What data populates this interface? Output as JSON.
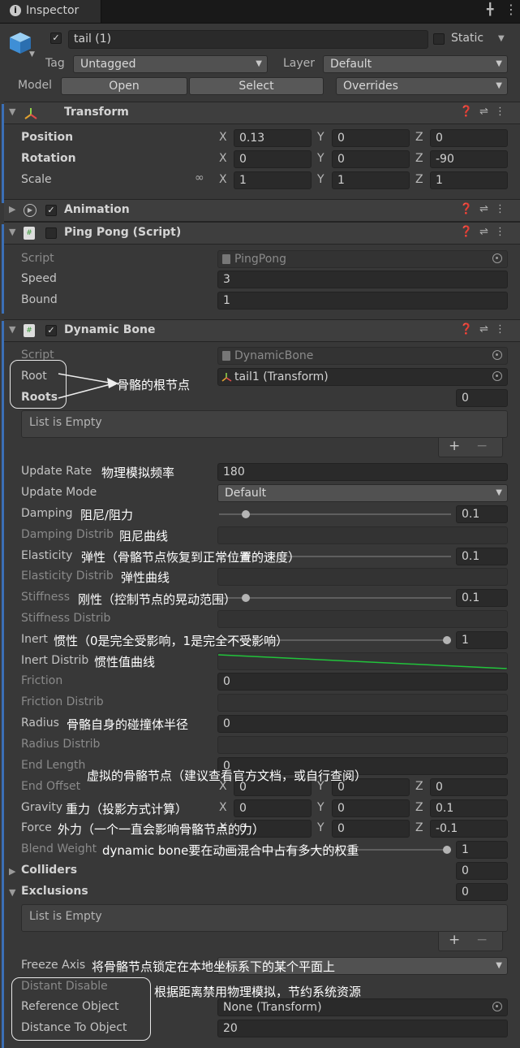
{
  "window": {
    "tab_title": "Inspector"
  },
  "object": {
    "name": "tail (1)",
    "static_label": "Static",
    "tag_label": "Tag",
    "tag_value": "Untagged",
    "layer_label": "Layer",
    "layer_value": "Default",
    "model_label": "Model",
    "open_label": "Open",
    "select_label": "Select",
    "overrides_label": "Overrides"
  },
  "transform": {
    "title": "Transform",
    "position_label": "Position",
    "rotation_label": "Rotation",
    "scale_label": "Scale",
    "position": {
      "x": "0.13",
      "y": "0",
      "z": "0"
    },
    "rotation": {
      "x": "0",
      "y": "0",
      "z": "-90"
    },
    "scale": {
      "x": "1",
      "y": "1",
      "z": "1"
    }
  },
  "axes": {
    "x": "X",
    "y": "Y",
    "z": "Z"
  },
  "animation": {
    "title": "Animation"
  },
  "pingpong": {
    "title": "Ping Pong (Script)",
    "script_label": "Script",
    "script_value": "PingPong",
    "speed_label": "Speed",
    "speed_value": "3",
    "bound_label": "Bound",
    "bound_value": "1"
  },
  "dynamic_bone": {
    "title": "Dynamic Bone",
    "script_label": "Script",
    "script_value": "DynamicBone",
    "root_label": "Root",
    "root_value": "tail1 (Transform)",
    "roots_label": "Roots",
    "roots_count": "0",
    "list_empty": "List is Empty",
    "update_rate_label": "Update Rate",
    "update_rate_value": "180",
    "update_mode_label": "Update Mode",
    "update_mode_value": "Default",
    "damping_label": "Damping",
    "damping_value": "0.1",
    "damping_fraction": 0.1,
    "damping_distrib_label": "Damping Distrib",
    "elasticity_label": "Elasticity",
    "elasticity_value": "0.1",
    "elasticity_fraction": 0.1,
    "elasticity_distrib_label": "Elasticity Distrib",
    "stiffness_label": "Stiffness",
    "stiffness_value": "0.1",
    "stiffness_fraction": 0.1,
    "stiffness_distrib_label": "Stiffness Distrib",
    "inert_label": "Inert",
    "inert_value": "1",
    "inert_fraction": 1.0,
    "inert_distrib_label": "Inert Distrib",
    "friction_label": "Friction",
    "friction_value": "0",
    "friction_distrib_label": "Friction Distrib",
    "radius_label": "Radius",
    "radius_value": "0",
    "radius_distrib_label": "Radius Distrib",
    "end_length_label": "End Length",
    "end_length_value": "0",
    "end_offset_label": "End Offset",
    "end_offset": {
      "x": "0",
      "y": "0",
      "z": "0"
    },
    "gravity_label": "Gravity",
    "gravity": {
      "x": "0",
      "y": "0",
      "z": "0.1"
    },
    "force_label": "Force",
    "force": {
      "x": "0",
      "y": "0",
      "z": "-0.1"
    },
    "blend_weight_label": "Blend Weight",
    "blend_weight_value": "1",
    "blend_weight_fraction": 1.0,
    "colliders_label": "Colliders",
    "colliders_count": "0",
    "exclusions_label": "Exclusions",
    "exclusions_count": "0",
    "freeze_axis_label": "Freeze Axis",
    "distant_disable_label": "Distant Disable",
    "reference_object_label": "Reference Object",
    "reference_object_value": "None (Transform)",
    "distance_to_object_label": "Distance To Object",
    "distance_to_object_value": "20"
  },
  "list_buttons": {
    "plus": "+",
    "minus": "−"
  },
  "annotations": {
    "root": "骨骼的根节点",
    "update_rate": "物理模拟频率",
    "damping": "阻尼/阻力",
    "damping_distrib": "阻尼曲线",
    "elasticity": "弹性（骨骼节点恢复到正常位置的速度）",
    "elasticity_distrib": "弹性曲线",
    "stiffness": "刚性（控制节点的晃动范围）",
    "inert": "惯性（0是完全受影响，1是完全不受影响）",
    "inert_distrib": "惯性值曲线",
    "radius": "骨骼自身的碰撞体半径",
    "end": "虚拟的骨骼节点（建议查看官方文档，或自行查阅）",
    "gravity": "重力（投影方式计算）",
    "force": "外力（一个一直会影响骨骼节点的力）",
    "blend_weight": "dynamic bone要在动画混合中占有多大的权重",
    "freeze_axis": "将骨骼节点锁定在本地坐标系下的某个平面上",
    "distant": "根据距离禁用物理模拟，节约系统资源"
  },
  "colors": {
    "accent_bar": "#3b6fb6",
    "curve": "#21c33b",
    "panel": "#383838",
    "field": "#2a2a2a"
  }
}
